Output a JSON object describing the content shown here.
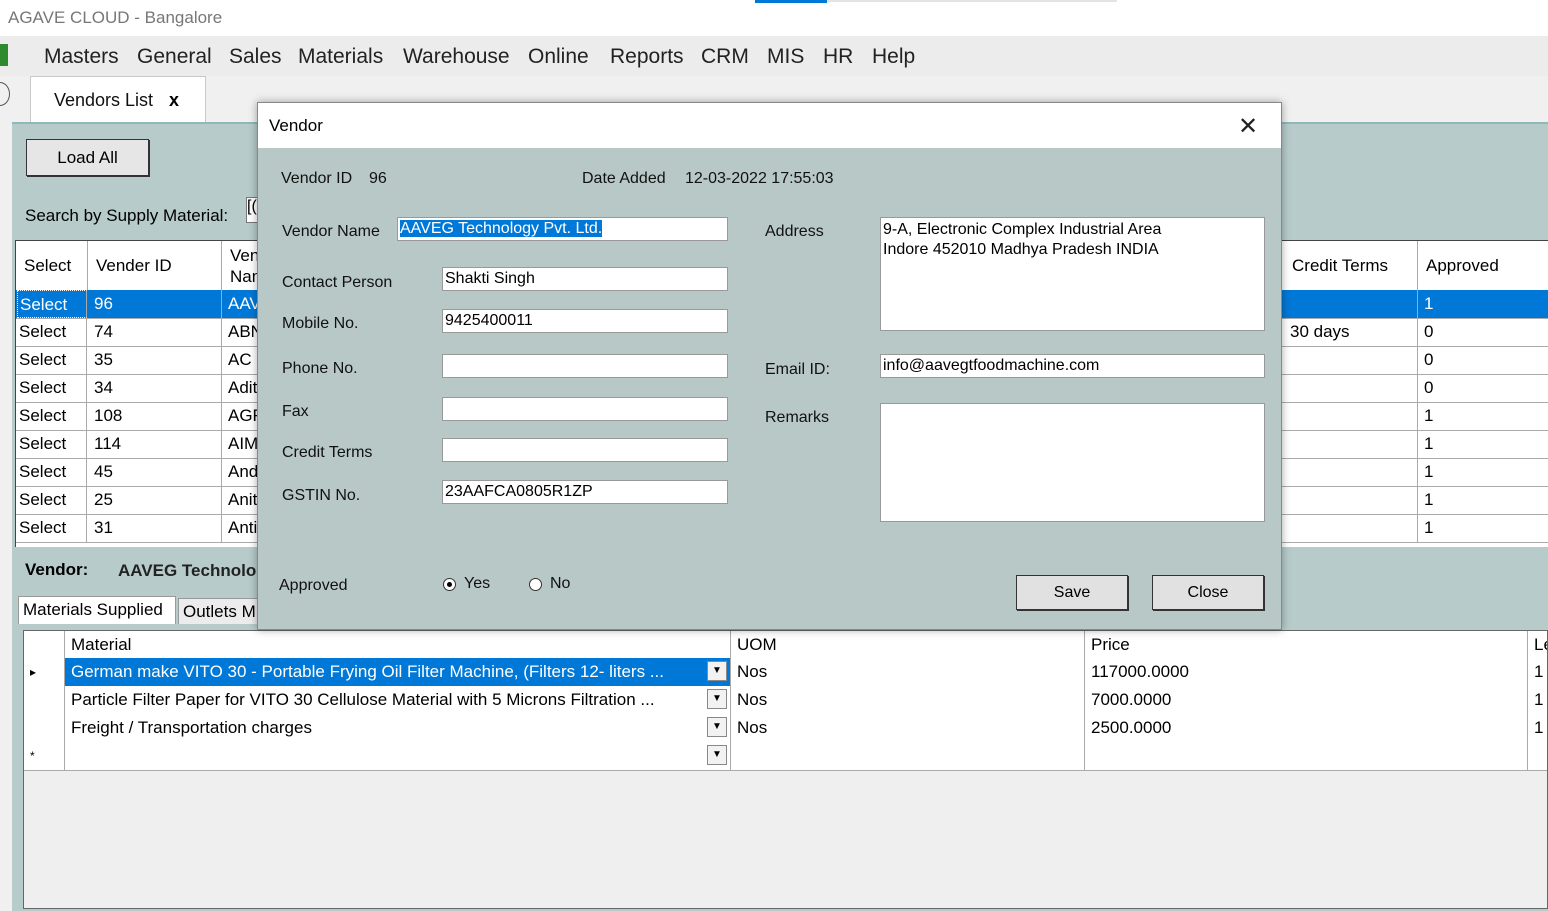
{
  "window": {
    "title": "AGAVE CLOUD - Bangalore"
  },
  "menu": {
    "items": [
      "Masters",
      "General",
      "Sales",
      "Materials",
      "Warehouse",
      "Online",
      "Reports",
      "CRM",
      "MIS",
      "HR",
      "Help"
    ]
  },
  "tabs": {
    "active_label": "Vendors List",
    "close_glyph": "x"
  },
  "toolbar": {
    "load_all": "Load All",
    "search_label": "Search by Supply Material:",
    "search_value": "[("
  },
  "vendor_grid": {
    "headers": {
      "select": "Select",
      "vendor_id": "Vender ID",
      "vendor_name": "Ven Nam",
      "credit_terms": "Credit Terms",
      "approved": "Approved"
    },
    "rows": [
      {
        "select": "Select",
        "id": "96",
        "name": "AAV",
        "credit": "",
        "approved": "1"
      },
      {
        "select": "Select",
        "id": "74",
        "name": "ABN",
        "credit": "30 days",
        "approved": "0"
      },
      {
        "select": "Select",
        "id": "35",
        "name": "AC E",
        "credit": "",
        "approved": "0"
      },
      {
        "select": "Select",
        "id": "34",
        "name": "Adity",
        "credit": "",
        "approved": "0"
      },
      {
        "select": "Select",
        "id": "108",
        "name": "AGR",
        "credit": "",
        "approved": "1"
      },
      {
        "select": "Select",
        "id": "114",
        "name": "AIMS",
        "credit": "",
        "approved": "1"
      },
      {
        "select": "Select",
        "id": "45",
        "name": "And",
        "credit": "",
        "approved": "1"
      },
      {
        "select": "Select",
        "id": "25",
        "name": "Anith",
        "credit": "",
        "approved": "1"
      },
      {
        "select": "Select",
        "id": "31",
        "name": "Anti",
        "credit": "",
        "approved": "1"
      }
    ]
  },
  "vendor_caption": {
    "label": "Vendor:",
    "value": "AAVEG Technolo"
  },
  "lower_tabs": {
    "materials": "Materials Supplied",
    "outlets": "Outlets M"
  },
  "materials_grid": {
    "headers": {
      "material": "Material",
      "uom": "UOM",
      "price": "Price",
      "last": "Le"
    },
    "rows": [
      {
        "marker": "▸",
        "material": "German make VITO 30 - Portable Frying Oil Filter Machine, (Filters 12- liters ...",
        "uom": "Nos",
        "price": "117000.0000",
        "last": "1"
      },
      {
        "marker": "",
        "material": "Particle Filter Paper for VITO 30 Cellulose Material with 5 Microns Filtration ...",
        "uom": "Nos",
        "price": "7000.0000",
        "last": "1"
      },
      {
        "marker": "",
        "material": "Freight / Transportation charges",
        "uom": "Nos",
        "price": "2500.0000",
        "last": "1"
      },
      {
        "marker": "*",
        "material": "",
        "uom": "",
        "price": "",
        "last": ""
      }
    ]
  },
  "dialog": {
    "title": "Vendor",
    "close_glyph": "✕",
    "vendor_id_label": "Vendor ID",
    "vendor_id": "96",
    "date_added_label": "Date Added",
    "date_added": "12-03-2022 17:55:03",
    "fields": {
      "vendor_name": {
        "label": "Vendor Name",
        "value": "AAVEG Technology Pvt. Ltd."
      },
      "contact_person": {
        "label": "Contact Person",
        "value": "Shakti Singh"
      },
      "mobile": {
        "label": "Mobile No.",
        "value": "9425400011"
      },
      "phone": {
        "label": "Phone No.",
        "value": ""
      },
      "fax": {
        "label": "Fax",
        "value": ""
      },
      "credit_terms": {
        "label": "Credit Terms",
        "value": ""
      },
      "gstin": {
        "label": "GSTIN No.",
        "value": "23AAFCA0805R1ZP"
      },
      "address": {
        "label": "Address",
        "line1": "9-A, Electronic Complex Industrial Area",
        "line2": "Indore 452010 Madhya Pradesh INDIA"
      },
      "email": {
        "label": "Email ID:",
        "value": "info@aavegtfoodmachine.com"
      },
      "remarks": {
        "label": "Remarks",
        "value": ""
      }
    },
    "approved": {
      "label": "Approved",
      "yes": "Yes",
      "no": "No",
      "selected": "Yes"
    },
    "buttons": {
      "save": "Save",
      "close": "Close"
    }
  },
  "colors": {
    "selection": "#0078d7",
    "panel": "#b7cbcb",
    "dialog": "#b7c8c6"
  }
}
